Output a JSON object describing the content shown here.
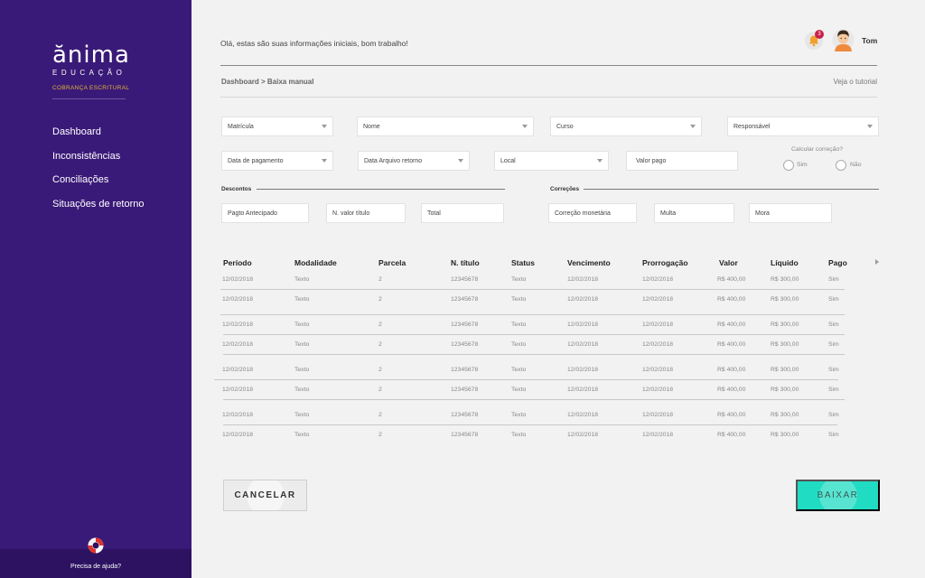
{
  "sidebar": {
    "logo_word": "ănima",
    "logo_sub": "EDUCAÇÃO",
    "logo_tag": "COBRANÇA ESCRITURAL",
    "nav": [
      "Dashboard",
      "Inconsistências",
      "Conciliações",
      "Situações de retorno"
    ],
    "help": "Precisa de ajuda?"
  },
  "header": {
    "greeting": "Olá, estas são suas informações iniciais, bom trabalho!",
    "notifications": "3",
    "user_name": "Tom",
    "breadcrumb": "Dashboard > Baixa manual",
    "tutorial": "Veja o tutorial"
  },
  "filters": {
    "matricula": "Matrícula",
    "nome": "Nome",
    "curso": "Curso",
    "responsavel": "Responsável",
    "data_pagamento": "Data de pagamento",
    "data_arquivo": "Data Arquivo retorno",
    "local": "Local",
    "valor_pago": "Valor pago",
    "calcular": "Calcular correção?",
    "sim": "Sim",
    "nao": "Não"
  },
  "descontos": {
    "title": "Descontos",
    "pagto": "Pagto Antecipado",
    "n_valor": "N. valor título",
    "total": "Total"
  },
  "correcoes": {
    "title": "Correções",
    "correcao": "Correção monetária",
    "multa": "Multa",
    "mora": "Mora"
  },
  "table": {
    "headers": [
      "Período",
      "Modalidade",
      "Parcela",
      "N. título",
      "Status",
      "Vencimento",
      "Prorrogação",
      "Valor",
      "Líquido",
      "Pago"
    ],
    "rows": [
      [
        "12/02/2018",
        "Texto",
        "2",
        "12345678",
        "Texto",
        "12/02/2018",
        "12/02/2018",
        "R$ 400,00",
        "R$ 300,00",
        "Sim"
      ],
      [
        "12/02/2018",
        "Texto",
        "2",
        "12345678",
        "Texto",
        "12/02/2018",
        "12/02/2018",
        "R$ 400,00",
        "R$ 300,00",
        "Sim"
      ],
      [
        "12/02/2018",
        "Texto",
        "2",
        "12345678",
        "Texto",
        "12/02/2018",
        "12/02/2018",
        "R$ 400,00",
        "R$ 300,00",
        "Sim"
      ],
      [
        "12/02/2018",
        "Texto",
        "2",
        "12345678",
        "Texto",
        "12/02/2018",
        "12/02/2018",
        "R$ 400,00",
        "R$ 300,00",
        "Sim"
      ],
      [
        "12/02/2018",
        "Texto",
        "2",
        "12345678",
        "Texto",
        "12/02/2018",
        "12/02/2018",
        "R$ 400,00",
        "R$ 300,00",
        "Sim"
      ],
      [
        "12/02/2018",
        "Texto",
        "2",
        "12345678",
        "Texto",
        "12/02/2018",
        "12/02/2018",
        "R$ 400,00",
        "R$ 300,00",
        "Sim"
      ],
      [
        "12/02/2018",
        "Texto",
        "2",
        "12345678",
        "Texto",
        "12/02/2018",
        "12/02/2018",
        "R$ 400,00",
        "R$ 300,00",
        "Sim"
      ],
      [
        "12/02/2018",
        "Texto",
        "2",
        "12345678",
        "Texto",
        "12/02/2018",
        "12/02/2018",
        "R$ 400,00",
        "R$ 300,00",
        "Sim"
      ]
    ]
  },
  "actions": {
    "cancel": "CANCELAR",
    "submit": "BAIXAR"
  },
  "colors": {
    "sidebar": "#3a1a78",
    "accent": "#1fdcc3",
    "badge": "#c8214a",
    "logo_tag": "#e0b23a"
  }
}
